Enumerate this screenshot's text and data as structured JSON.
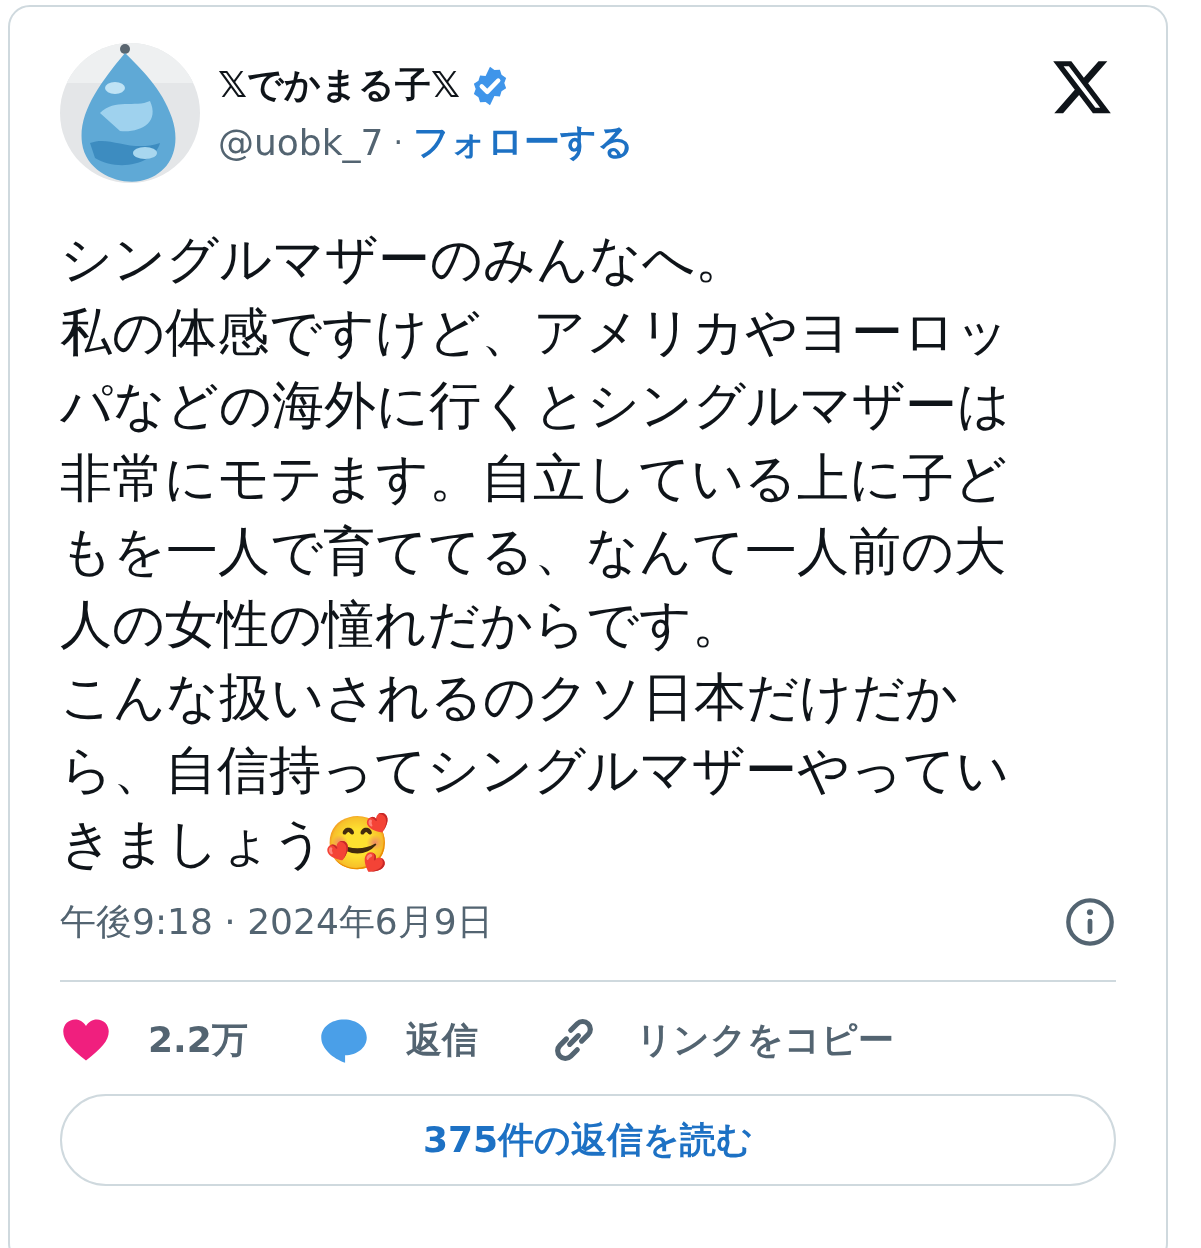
{
  "author": {
    "name": "𝕏でかまる子𝕏",
    "verified": true,
    "handle": "@uobk_7",
    "separator": "·",
    "follow": "フォローする"
  },
  "body": [
    "シングルマザーのみんなへ。",
    "私の体感ですけど、アメリカやヨーロッ",
    "パなどの海外に行くとシングルマザーは",
    "非常にモテます。自立している上に子ど",
    "もを一人で育ててる、なんて一人前の大",
    "人の女性の憧れだからです。",
    "こんな扱いされるのクソ日本だけだか",
    "ら、自信持ってシングルマザーやってい",
    "きましょう🥰"
  ],
  "timestamp": "午後9:18 · 2024年6月9日",
  "actions": [
    {
      "kind": "like",
      "label": "2.2万"
    },
    {
      "kind": "reply",
      "label": "返信"
    },
    {
      "kind": "copy",
      "label": "リンクをコピー"
    }
  ],
  "read_replies": "375件の返信を読む"
}
